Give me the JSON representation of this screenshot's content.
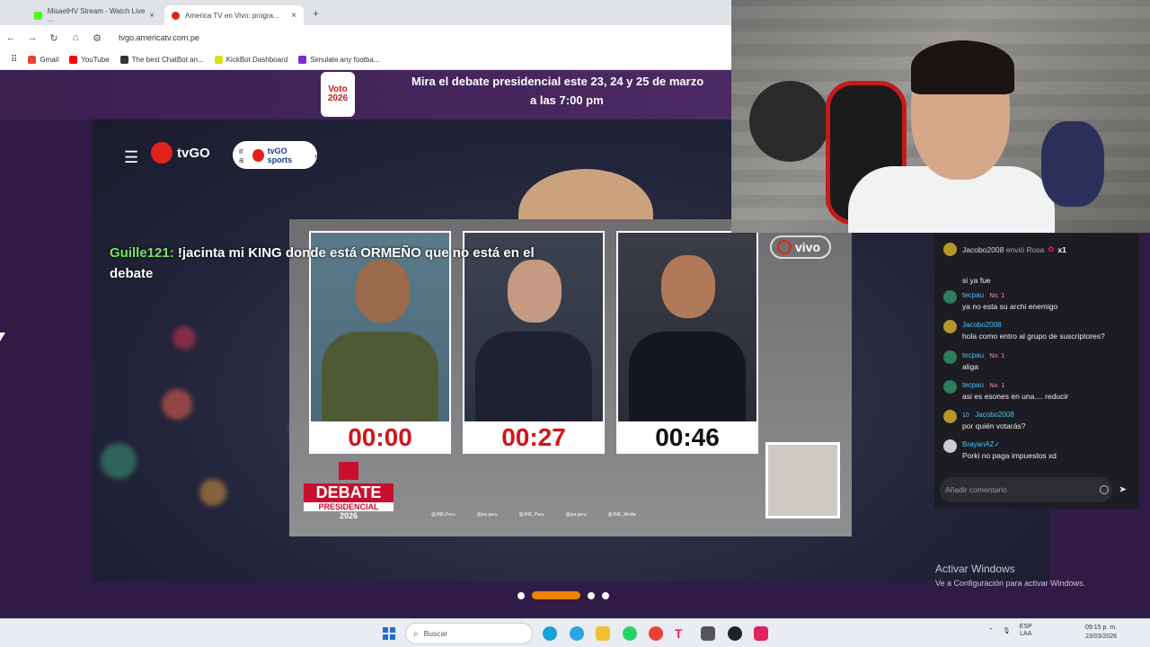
{
  "browser": {
    "tabs": [
      {
        "label": "MisaelHV Stream - Watch Live ..."
      },
      {
        "label": "America TV en Vivo: progra..."
      }
    ],
    "new_tab": "+",
    "url": "tvgo.americatv.com.pe",
    "bookmarks": [
      {
        "label": "Gmail"
      },
      {
        "label": "YouTube"
      },
      {
        "label": "The best ChatBot an..."
      },
      {
        "label": "KickBot Dashboard"
      },
      {
        "label": "Simulate any footba..."
      }
    ]
  },
  "banner": {
    "logo_line1": "Voto",
    "logo_line2": "2026",
    "line1": "Mira el debate presidencial este 23, 24 y 25 de marzo",
    "line2": "a las 7:00 pm"
  },
  "header": {
    "logo_text": "tvGO",
    "sports_button_prefix": "ir a",
    "sports_button_brand": "tvGO sports"
  },
  "overlay_chat": {
    "user": "Guille121:",
    "message": "!jacinta mi KING donde está ORMEÑO que no está en el debate"
  },
  "video": {
    "live_badge": "vivo",
    "timers": [
      "00:00",
      "00:27",
      "00:46"
    ],
    "debate_logo": {
      "title": "DEBATE",
      "subtitle": "PRESIDENCIAL",
      "year": "2026",
      "org": "JNE"
    },
    "socials": [
      "@JNE.Peru",
      "@jne.peru",
      "@JNE_Peru",
      "@jne.peru",
      "@JNE_Media"
    ]
  },
  "live_chat": {
    "gift": {
      "user": "Jacobo2008",
      "action": "envió Rosa",
      "count": "x1"
    },
    "messages": [
      {
        "name": "",
        "badge": "",
        "text": "si ya fue"
      },
      {
        "name": "tecpau",
        "badge": "No. 1",
        "text": "ya no esta su archi enemigo"
      },
      {
        "name": "Jacobo2008",
        "badge": "",
        "text": "hola como entro al grupo de suscriptores?"
      },
      {
        "name": "tecpau",
        "badge": "No. 1",
        "text": "aliga"
      },
      {
        "name": "tecpau",
        "badge": "No. 1",
        "text": "asi es esones en una.... reducir"
      },
      {
        "name": "Jacobo2008",
        "badge": "10",
        "text": "por quién votarás?"
      },
      {
        "name": "BrayanAZ✓",
        "badge": "",
        "text": "Porki no paga impuestos xd"
      }
    ],
    "input_placeholder": "Añadir comentario"
  },
  "activate_windows": {
    "title": "Activar Windows",
    "subtitle": "Ve a Configuración para activar Windows."
  },
  "taskbar": {
    "search_placeholder": "Buscar",
    "lang_top": "ESP",
    "lang_bottom": "LAA",
    "time": "09:15 p. m.",
    "date": "23/03/2026"
  }
}
